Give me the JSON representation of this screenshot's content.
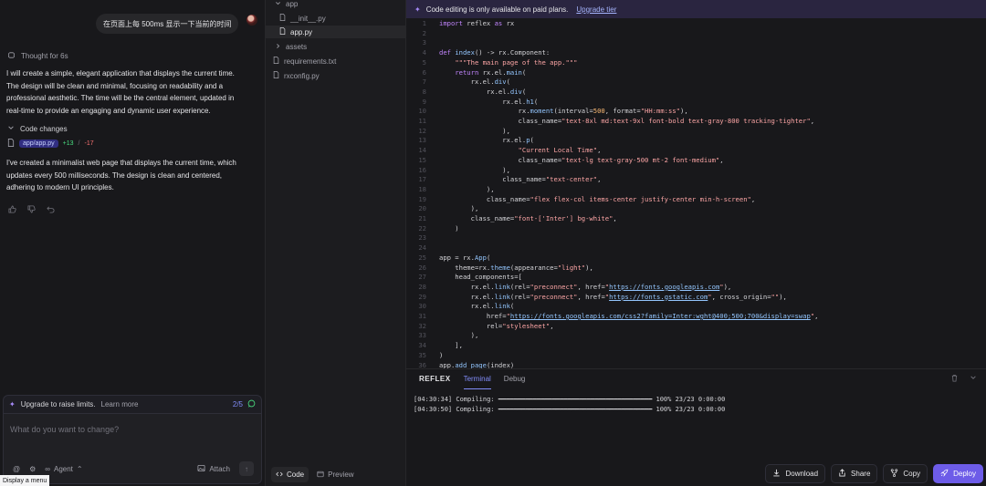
{
  "chat": {
    "user_message": "在页面上每 500ms 显示一下当前的时间",
    "thought": "Thought for 6s",
    "response_1": "I will create a simple, elegant application that displays the current time. The design will be clean and minimal, focusing on readability and a professional aesthetic. The time will be the central element, updated in real-time to provide an engaging and dynamic user experience.",
    "code_changes_label": "Code changes",
    "changed_file": "app/app.py",
    "additions": "+13",
    "separator": "/",
    "deletions": "-17",
    "response_2": "I've created a minimalist web page that displays the current time, which updates every 500 milliseconds. The design is clean and centered, adhering to modern UI principles.",
    "upgrade_text": "Upgrade to raise limits.",
    "learn_more": "Learn more",
    "usage_count": "2/5",
    "input_placeholder": "What do you want to change?",
    "agent_label": "Agent",
    "attach_label": "Attach",
    "tooltip": "Display a menu"
  },
  "tree": {
    "items": [
      {
        "label": "app",
        "type": "folder-open"
      },
      {
        "label": "__init__.py",
        "type": "file"
      },
      {
        "label": "app.py",
        "type": "file",
        "active": true
      },
      {
        "label": "assets",
        "type": "folder"
      },
      {
        "label": "requirements.txt",
        "type": "file"
      },
      {
        "label": "rxconfig.py",
        "type": "file"
      }
    ],
    "tab_code": "Code",
    "tab_preview": "Preview"
  },
  "editor": {
    "banner_text": "Code editing is only available on paid plans.",
    "banner_link": "Upgrade tier",
    "lines": [
      "1",
      "2",
      "3",
      "4",
      "5",
      "6",
      "7",
      "8",
      "9",
      "10",
      "11",
      "12",
      "13",
      "14",
      "15",
      "16",
      "17",
      "18",
      "19",
      "20",
      "21",
      "22",
      "23",
      "24",
      "25",
      "26",
      "27",
      "28",
      "29",
      "30",
      "31",
      "32",
      "33",
      "34",
      "35",
      "36"
    ]
  },
  "terminal": {
    "logo": "REFLEX",
    "tab_terminal": "Terminal",
    "tab_debug": "Debug",
    "log_1": "[04:30:34] Compiling: ━━━━━━━━━━━━━━━━━━━━━━━━━━━━━━━━━━━━━━━━ 100% 23/23 0:00:00",
    "log_2": "[04:30:50] Compiling: ━━━━━━━━━━━━━━━━━━━━━━━━━━━━━━━━━━━━━━━━ 100% 23/23 0:00:00"
  },
  "actions": {
    "download": "Download",
    "share": "Share",
    "copy": "Copy",
    "deploy": "Deploy"
  },
  "colors": {
    "accent": "#6d5ce8",
    "addition": "#4ade80",
    "deletion": "#f87171"
  }
}
